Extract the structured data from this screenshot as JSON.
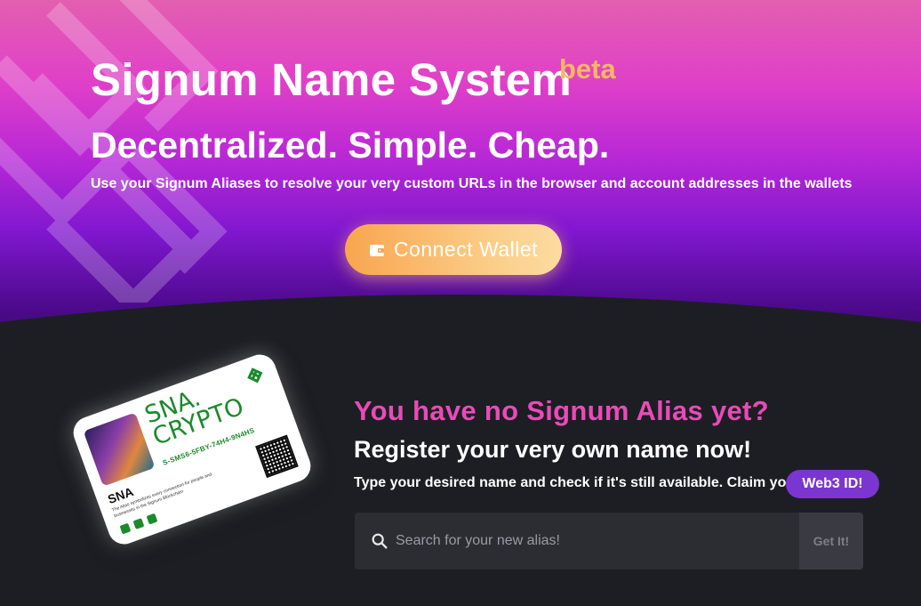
{
  "hero": {
    "title": "Signum Name System",
    "badge": "beta",
    "subtitle": "Decentralized. Simple. Cheap.",
    "tagline": "Use your Signum Aliases to resolve your very custom URLs in the browser and account addresses in the wallets",
    "connect_label": "Connect Wallet",
    "connect_icon": "wallet-icon"
  },
  "card": {
    "title": "SNA. CRYPTO",
    "address": "S-SMS6-5FBY-74H4-9N4HS",
    "name": "SNA",
    "description": "The Alias symbolizes every connection for people and businesses in the Signum Blockchain",
    "icons": [
      "github-icon",
      "youtube-icon",
      "twitter-icon"
    ]
  },
  "register": {
    "heading": "You have no Signum Alias yet?",
    "subheading": "Register your very own name now!",
    "description": "Type your desired name and check if it's still available. Claim your",
    "badge": "Web3 ID!"
  },
  "search": {
    "placeholder": "Search for your new alias!",
    "value": "",
    "button_label": "Get It!",
    "icon": "search-icon"
  },
  "colors": {
    "accent_pink": "#e84bb7",
    "button_orange": "#f9a54e",
    "beta_yellow": "#f6b860",
    "badge_purple": "#7b36d1",
    "dark_bg": "#1d1e24",
    "card_green": "#1c8a2c"
  }
}
